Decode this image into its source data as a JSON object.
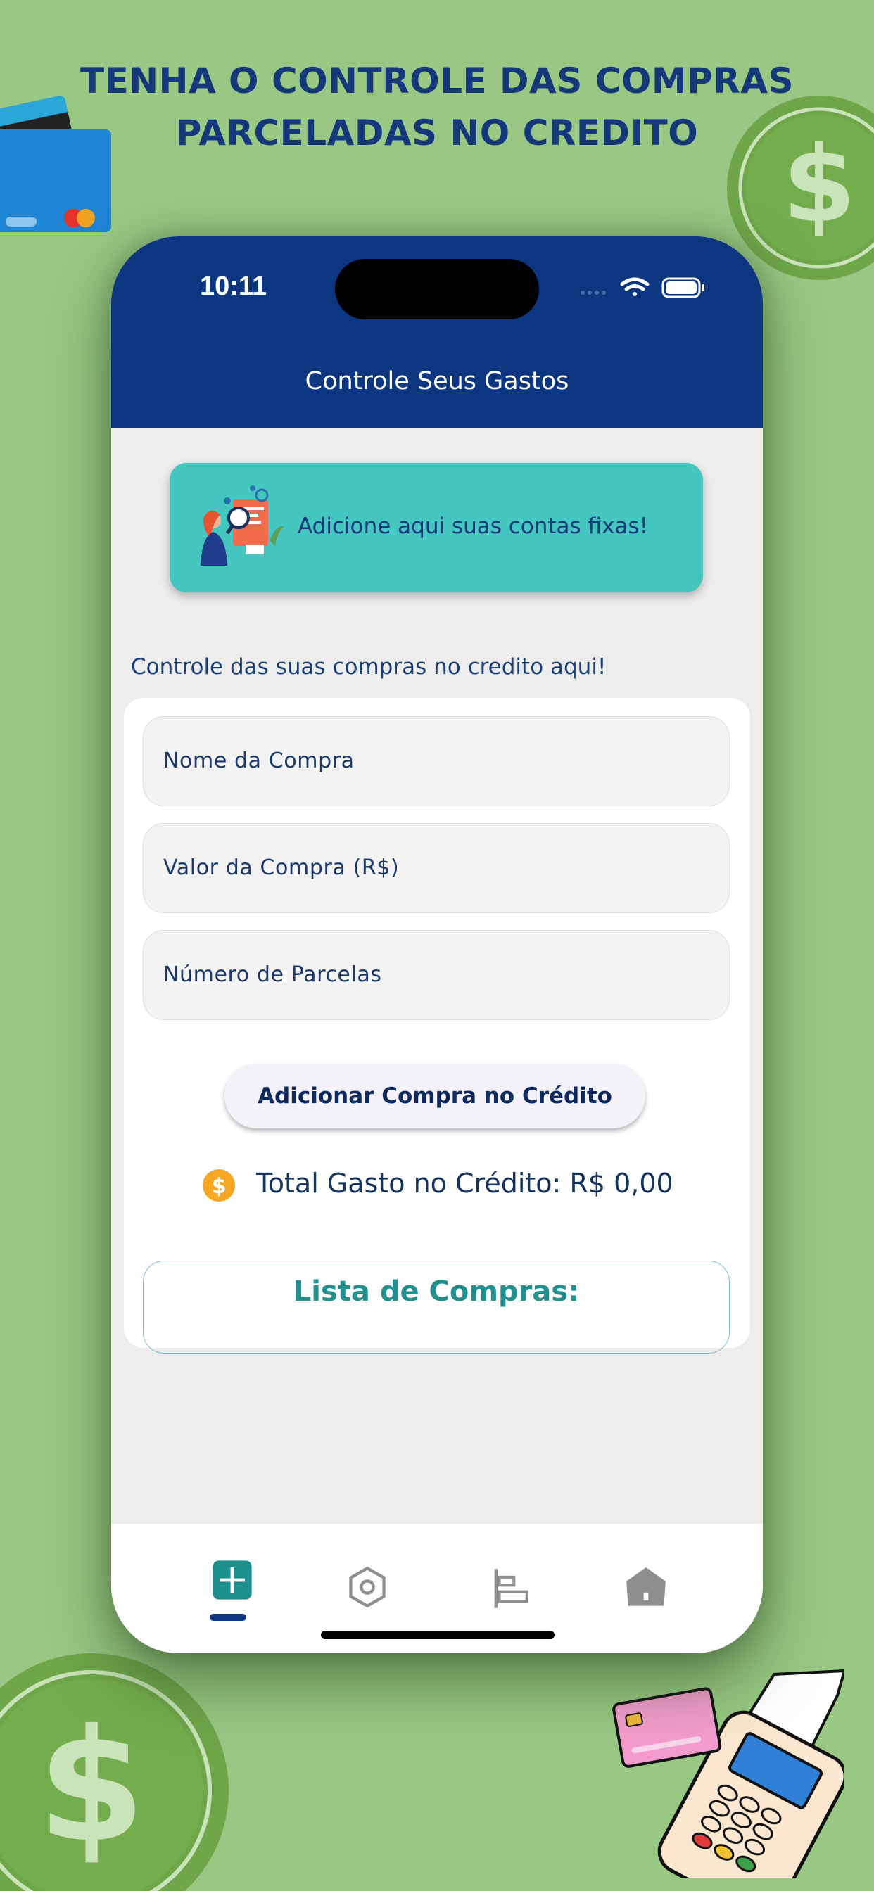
{
  "promo": {
    "headline_line1": "TENHA O CONTROLE DAS COMPRAS",
    "headline_line2": "PARCELADAS NO CREDITO"
  },
  "status_bar": {
    "time": "10:11",
    "icons": [
      "cellular-dots-icon",
      "wifi-icon",
      "battery-icon"
    ]
  },
  "app_bar": {
    "title": "Controle Seus Gastos"
  },
  "banner": {
    "text": "Adicione aqui suas contas fixas!"
  },
  "credit_section": {
    "caption": "Controle das suas compras no credito aqui!",
    "fields": {
      "name_placeholder": "Nome da Compra",
      "value_placeholder": "Valor da Compra (R$)",
      "installments_placeholder": "Número de Parcelas"
    },
    "add_button_label": "Adicionar Compra no Crédito",
    "total_label": "Total Gasto no Crédito: R$ 0,00",
    "list_title": "Lista de Compras:"
  },
  "bottom_nav": {
    "items": [
      {
        "icon": "add-box-icon",
        "selected": true
      },
      {
        "icon": "hexagon-icon",
        "selected": false
      },
      {
        "icon": "align-bars-icon",
        "selected": false
      },
      {
        "icon": "home-icon",
        "selected": false
      }
    ]
  },
  "colors": {
    "background": "#98c884",
    "headline": "#14387a",
    "app_bar": "#0d3680",
    "banner": "#45c6c0",
    "list_title": "#21908e",
    "coin": "#f5a623"
  }
}
